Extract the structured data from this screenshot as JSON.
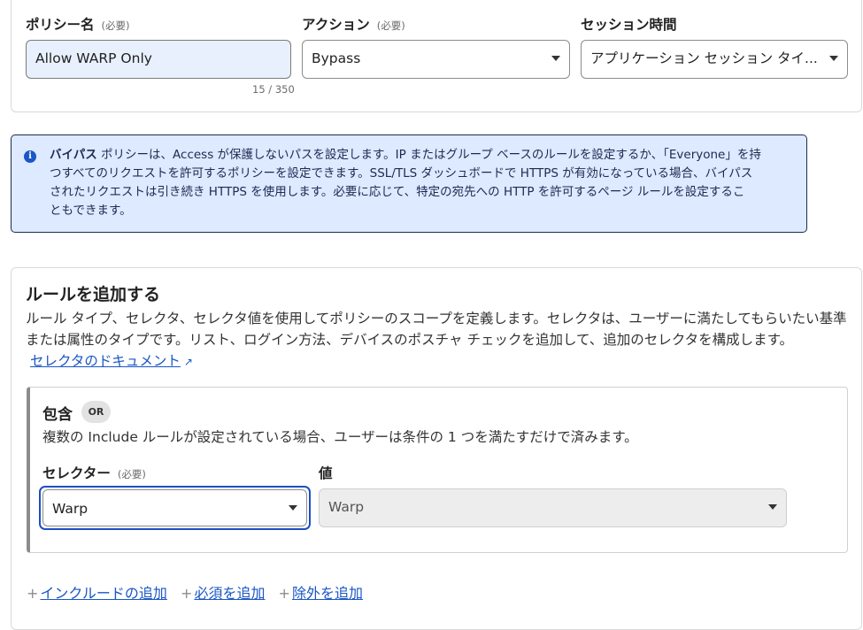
{
  "policy_form": {
    "name_label": "ポリシー名",
    "name_required": "(必要)",
    "name_value": "Allow WARP Only",
    "name_counter": "15 / 350",
    "action_label": "アクション",
    "action_required": "(必要)",
    "action_value": "Bypass",
    "session_label": "セッション時間",
    "session_value": "アプリケーション セッション タイ..."
  },
  "info_banner": {
    "bold_lead": "バイパス",
    "lines": [
      " ポリシーは、Access が保護しないパスを設定します。IP またはグループ ベースのルールを設定するか、「Everyone」を持",
      "つすべてのリクエストを許可するポリシーを設定できます。SSL/TLS ダッシュボードで HTTPS が有効になっている場合、バイパス",
      "されたリクエストは引き続き HTTPS を使用します。必要に応じて、特定の宛先への HTTP を許可するページ ルールを設定するこ",
      "ともできます。"
    ]
  },
  "rules": {
    "title": "ルールを追加する",
    "description": "ルール タイプ、セレクタ、セレクタ値を使用してポリシーのスコープを定義します。セレクタは、ユーザーに満たしてもらいたい基準または属性のタイプです。リスト、ログイン方法、デバイスのポスチャ チェックを追加して、追加のセレクタを構成します。",
    "doc_link": "セレクタのドキュメント",
    "include": {
      "title": "包含",
      "badge": "OR",
      "description": "複数の Include ルールが設定されている場合、ユーザーは条件の 1 つを満たすだけで済みます。",
      "selector_label": "セレクター",
      "selector_required": "(必要)",
      "selector_value": "Warp",
      "value_label": "値",
      "value_value": "Warp"
    },
    "footer_links": {
      "add_include": "インクルードの追加",
      "add_require": "必須を追加",
      "add_exclude": "除外を追加"
    }
  },
  "icons": {
    "info": "info-icon",
    "external_link": "external-link-icon",
    "dropdown": "chevron-down-icon",
    "plus": "plus-icon"
  },
  "colors": {
    "accent": "#1a56c6",
    "info_bg": "#ddeaff",
    "input_autofill_bg": "#e8f0fe"
  }
}
